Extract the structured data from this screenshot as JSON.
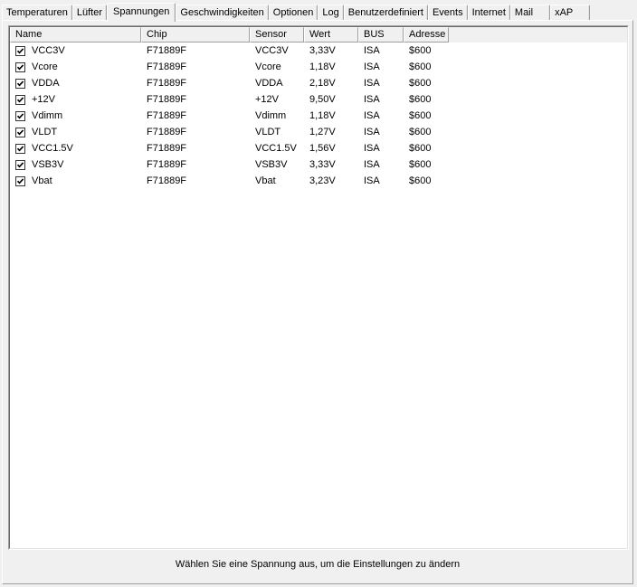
{
  "tabs": [
    {
      "id": "temperaturen",
      "label": "Temperaturen",
      "active": false
    },
    {
      "id": "luefter",
      "label": "Lüfter",
      "active": false
    },
    {
      "id": "spannungen",
      "label": "Spannungen",
      "active": true
    },
    {
      "id": "geschwindigkeiten",
      "label": "Geschwindigkeiten",
      "active": false
    },
    {
      "id": "optionen",
      "label": "Optionen",
      "active": false
    },
    {
      "id": "log",
      "label": "Log",
      "active": false
    },
    {
      "id": "benutzerdefiniert",
      "label": "Benutzerdefiniert",
      "active": false
    },
    {
      "id": "events",
      "label": "Events",
      "active": false
    },
    {
      "id": "internet",
      "label": "Internet",
      "active": false
    },
    {
      "id": "mail",
      "label": "Mail",
      "active": false
    },
    {
      "id": "xap",
      "label": "xAP",
      "active": false
    }
  ],
  "table": {
    "columns": [
      "Name",
      "Chip",
      "Sensor",
      "Wert",
      "BUS",
      "Adresse"
    ],
    "rows": [
      {
        "checked": true,
        "name": "VCC3V",
        "chip": "F71889F",
        "sensor": "VCC3V",
        "wert": "3,33V",
        "bus": "ISA",
        "adresse": "$600"
      },
      {
        "checked": true,
        "name": "Vcore",
        "chip": "F71889F",
        "sensor": "Vcore",
        "wert": "1,18V",
        "bus": "ISA",
        "adresse": "$600"
      },
      {
        "checked": true,
        "name": "VDDA",
        "chip": "F71889F",
        "sensor": "VDDA",
        "wert": "2,18V",
        "bus": "ISA",
        "adresse": "$600"
      },
      {
        "checked": true,
        "name": "+12V",
        "chip": "F71889F",
        "sensor": "+12V",
        "wert": "9,50V",
        "bus": "ISA",
        "adresse": "$600"
      },
      {
        "checked": true,
        "name": "Vdimm",
        "chip": "F71889F",
        "sensor": "Vdimm",
        "wert": "1,18V",
        "bus": "ISA",
        "adresse": "$600"
      },
      {
        "checked": true,
        "name": "VLDT",
        "chip": "F71889F",
        "sensor": "VLDT",
        "wert": "1,27V",
        "bus": "ISA",
        "adresse": "$600"
      },
      {
        "checked": true,
        "name": "VCC1.5V",
        "chip": "F71889F",
        "sensor": "VCC1.5V",
        "wert": "1,56V",
        "bus": "ISA",
        "adresse": "$600"
      },
      {
        "checked": true,
        "name": "VSB3V",
        "chip": "F71889F",
        "sensor": "VSB3V",
        "wert": "3,33V",
        "bus": "ISA",
        "adresse": "$600"
      },
      {
        "checked": true,
        "name": "Vbat",
        "chip": "F71889F",
        "sensor": "Vbat",
        "wert": "3,23V",
        "bus": "ISA",
        "adresse": "$600"
      }
    ]
  },
  "status_text": "Wählen Sie eine Spannung aus, um die Einstellungen zu ändern",
  "icons": {
    "checkbox_mark": "check-icon"
  }
}
